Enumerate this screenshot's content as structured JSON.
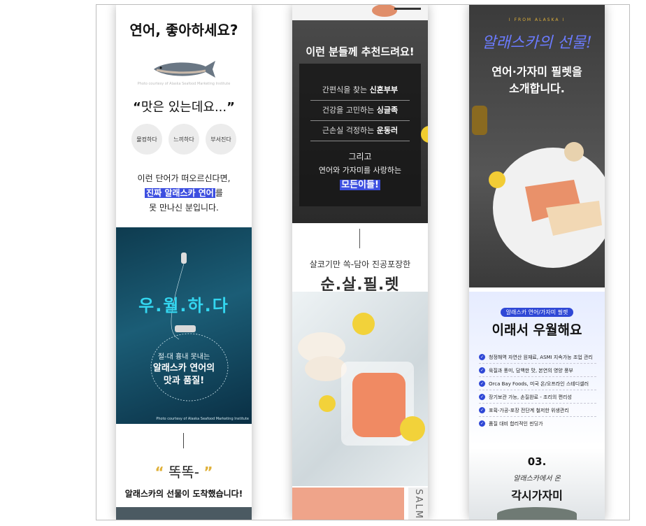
{
  "panel1": {
    "title": "연어, 좋아하세요?",
    "photo_credit": "Photo courtesy of Alaska Seafood Marketing Institute",
    "quote": "맛은 있는데요...",
    "quote_open": "“",
    "quote_close": "”",
    "bubbles": [
      "물컹하다",
      "느끼하다",
      "부서진다"
    ],
    "line1": "이런 단어가 떠오르신다면,",
    "line2_highlight": "진짜 알래스카 연어",
    "line2_rest": "를",
    "line3": "못 만나신 분입니다.",
    "banner_title": "우.월.하.다",
    "banner_sub": "절-대 흉내 못내는",
    "banner_emph1": "알래스카 연어의",
    "banner_emph2": "맛과 품질!",
    "banner_credit": "Photo courtesy of Alaska Seafood Marketing Institute",
    "knock": "똑똑-",
    "arrived": "알래스카의 선물이 도착했습니다!"
  },
  "panel2": {
    "title": "이런 분들께 추천드려요!",
    "rows": [
      {
        "text": "간편식을 찾는 ",
        "bold": "신혼부부"
      },
      {
        "text": "건강을 고민하는 ",
        "bold": "싱글족"
      },
      {
        "text": "근손실 걱정하는 ",
        "bold": "운동러"
      }
    ],
    "and": "그리고",
    "lovers": "연어와 가자미를 사랑하는",
    "everyone": "모든이들!",
    "vac_text": "살코기만 쏙-담아 진공포장한",
    "fillet_title": "순.살.필.렛",
    "side_text": "SALMO"
  },
  "panel3": {
    "from": "I FROM ALASKA I",
    "gift": "알래스카의 선물!",
    "intro1": "연어·가자미 필렛을",
    "intro2": "소개합니다.",
    "badge": "알래스카 연어/가자미 필렛",
    "why": "이래서 우월해요",
    "checks": [
      "청정해역 자연산 원재료, ASMI 지속가능 조업 관리",
      "육질과 풍미, 담백한 맛, 본연의 영양 풍부",
      "Orca Bay Foods, 미국 온/오프라인 스테디셀러",
      "장기보관 가능, 손질완료 - 조리의 편리성",
      "포획-가공-포장 전단계 철저한 위생관리",
      "품질 대비 합리적인 핀딩가"
    ],
    "num": "03.",
    "script_line": "알래스카에서 온",
    "flounder": "각시가자미"
  },
  "colors": {
    "accent": "#3d4fe0",
    "gold": "#e0b13a",
    "cyan": "#33d6f0",
    "dark": "#2d2d2d"
  }
}
